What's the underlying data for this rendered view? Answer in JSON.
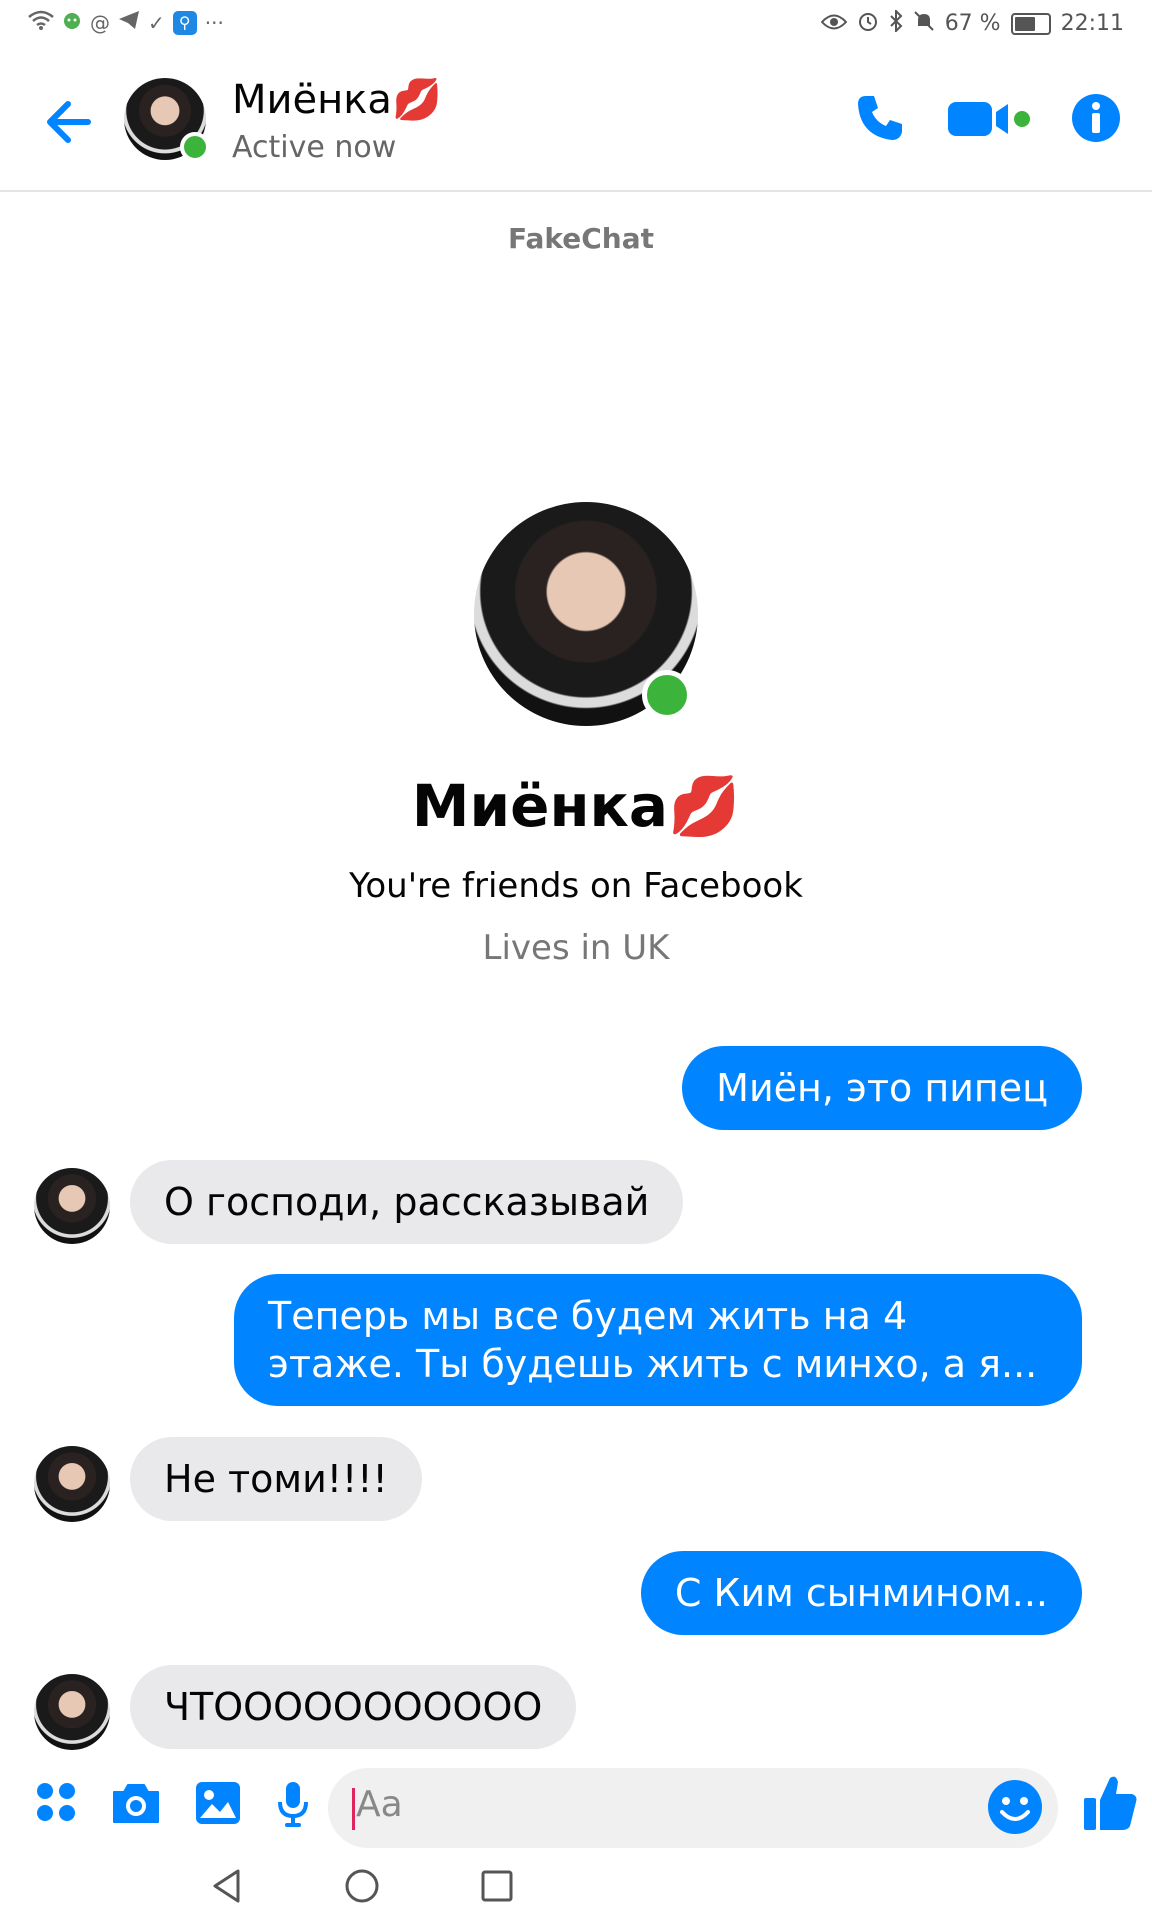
{
  "status_bar": {
    "left_icons": [
      "wifi-icon",
      "android-icon",
      "at-icon",
      "telegram-icon",
      "check-icon",
      "search-app-icon",
      "more-icon"
    ],
    "more": "···",
    "right_icons": [
      "eye-icon",
      "alarm-icon",
      "bluetooth-icon",
      "mute-icon"
    ],
    "battery_percent": "67 %",
    "battery_level": 0.67,
    "time": "22:11"
  },
  "header": {
    "contact_name": "Миёнка💋",
    "status": "Active now",
    "watermark": "FakeChat",
    "online": true,
    "accent_color": "#0084ff"
  },
  "profile": {
    "name": "Миёнка💋",
    "friends_text": "You're friends on Facebook",
    "location_text": "Lives in UK"
  },
  "messages": [
    {
      "direction": "sent",
      "text": "Миён, это пипец"
    },
    {
      "direction": "received",
      "text": "О господи, рассказывай"
    },
    {
      "direction": "sent",
      "text": "Теперь мы все будем жить на 4 этаже. Ты будешь жить с минхо, а я..."
    },
    {
      "direction": "received",
      "text": "Не томи!!!!"
    },
    {
      "direction": "sent",
      "text": "С Ким сынмином..."
    },
    {
      "direction": "received",
      "text": "ЧТООООООООООО"
    }
  ],
  "composer": {
    "placeholder": "Aa",
    "icons": [
      "apps-icon",
      "camera-icon",
      "gallery-icon",
      "microphone-icon",
      "emoji-icon",
      "thumbs-up-icon"
    ]
  },
  "nav_bar": {
    "buttons": [
      "back-nav-icon",
      "home-nav-icon",
      "recents-nav-icon"
    ]
  }
}
